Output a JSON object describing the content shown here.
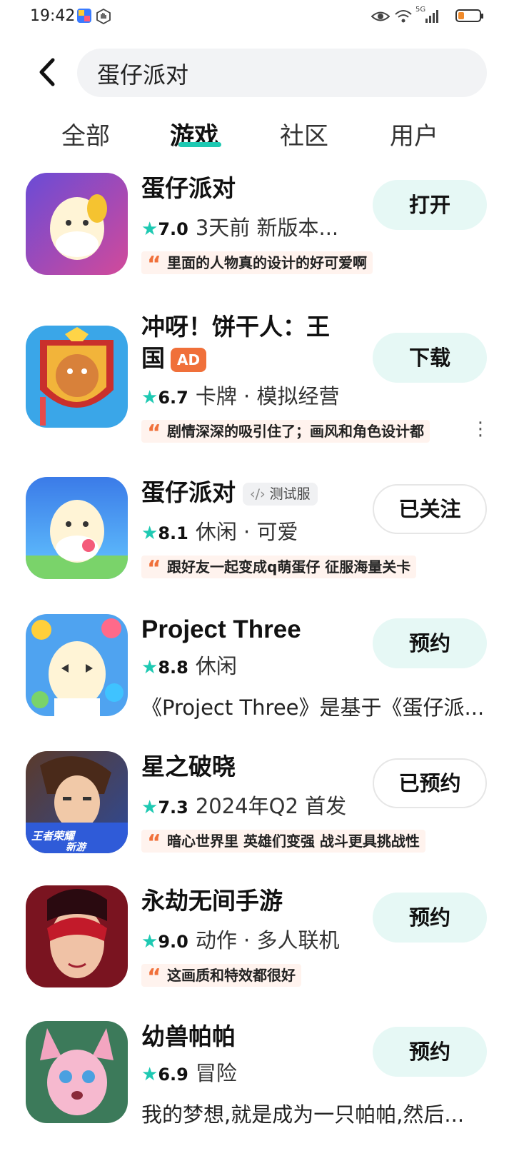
{
  "status_bar": {
    "time": "19:42",
    "signal_label": "5G"
  },
  "search": {
    "query": "蛋仔派对"
  },
  "tabs": [
    {
      "label": "全部",
      "active": false
    },
    {
      "label": "游戏",
      "active": true
    },
    {
      "label": "社区",
      "active": false
    },
    {
      "label": "用户",
      "active": false
    }
  ],
  "colors": {
    "accent": "#1ec9b2",
    "ad_badge": "#f0703a",
    "button_bg": "#e6f8f5"
  },
  "apps": [
    {
      "title": "蛋仔派对",
      "rating": "7.0",
      "info": "3天前 新版本...",
      "quote": "里面的人物真的设计的好可爱啊",
      "button": "打开"
    },
    {
      "title_line1": "冲呀！饼干人：王",
      "title_line2": "国",
      "badge": "AD",
      "rating": "6.7",
      "info": "卡牌 · 模拟经营",
      "quote": "剧情深深的吸引住了；画风和角色设计都",
      "button": "下载"
    },
    {
      "title": "蛋仔派对",
      "badge": "测试服",
      "rating": "8.1",
      "info": "休闲 · 可爱",
      "quote": "跟好友一起变成q萌蛋仔 征服海量关卡",
      "button": "已关注"
    },
    {
      "title": "Project Three",
      "rating": "8.8",
      "info": "休闲",
      "description": "《Project Three》是基于《蛋仔派...",
      "button": "预约"
    },
    {
      "title": "星之破晓",
      "rating": "7.3",
      "info": "2024年Q2 首发",
      "quote": "暗心世界里 英雄们变强 战斗更具挑战性",
      "button": "已预约",
      "icon_caption_1": "王者荣耀",
      "icon_caption_2": "新游"
    },
    {
      "title": "永劫无间手游",
      "rating": "9.0",
      "info": "动作 · 多人联机",
      "quote": "这画质和特效都很好",
      "button": "预约"
    },
    {
      "title": "幼兽帕帕",
      "rating": "6.9",
      "info": "冒险",
      "description": "我的梦想,就是成为一只帕帕,然后...",
      "button": "预约"
    }
  ]
}
